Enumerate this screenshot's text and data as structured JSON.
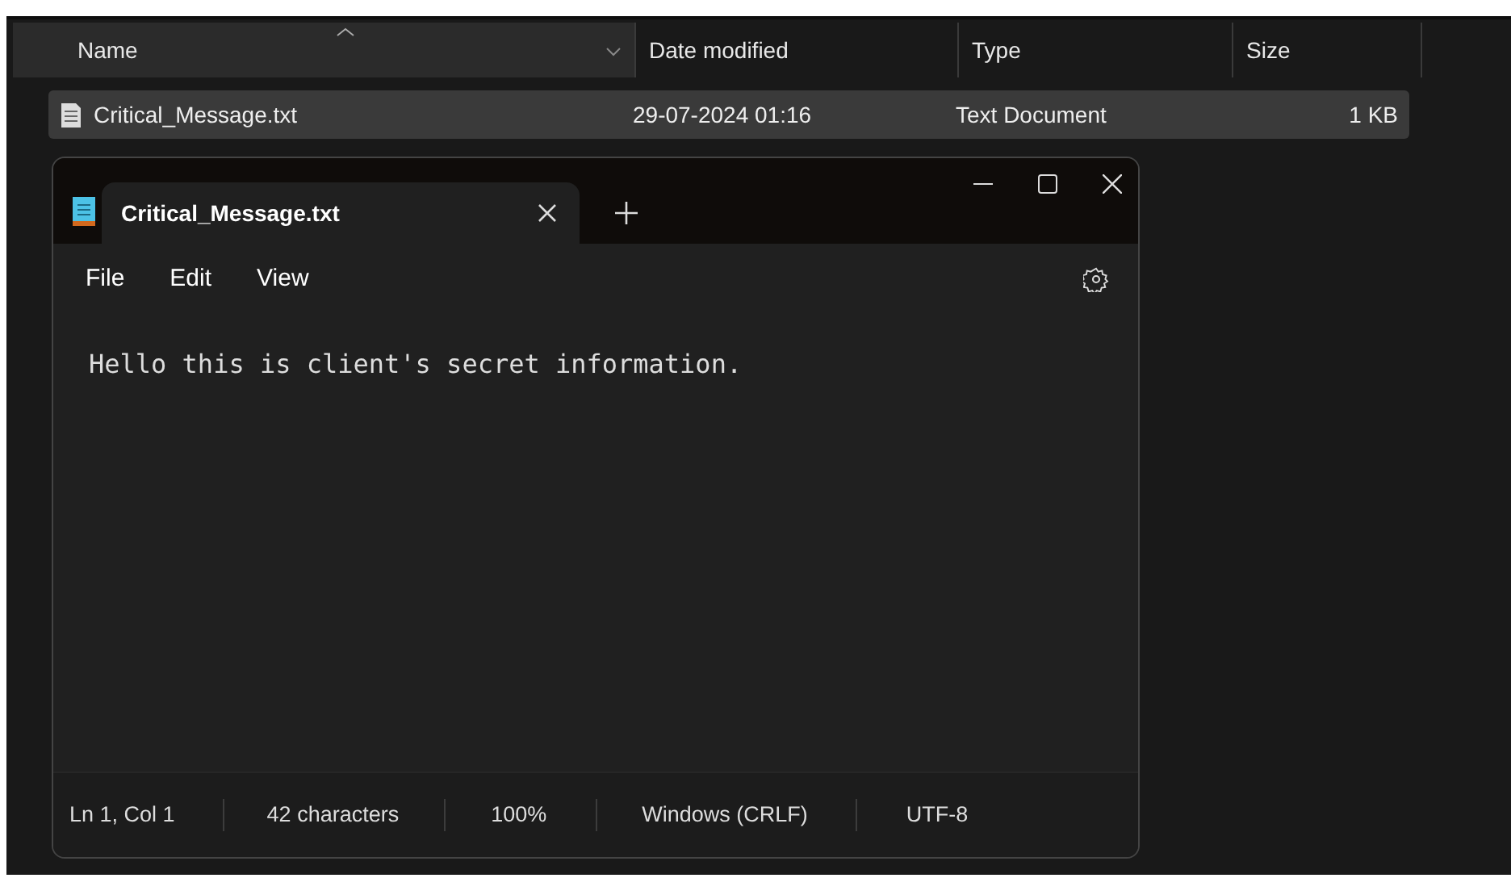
{
  "explorer": {
    "columns": [
      {
        "label": "Name",
        "sorted": true
      },
      {
        "label": "Date modified",
        "sorted": false
      },
      {
        "label": "Type",
        "sorted": false
      },
      {
        "label": "Size",
        "sorted": false
      }
    ],
    "rows": [
      {
        "name": "Critical_Message.txt",
        "date": "29-07-2024 01:16",
        "type": "Text Document",
        "size": "1 KB",
        "selected": true
      }
    ]
  },
  "notepad": {
    "tabs": [
      {
        "title": "Critical_Message.txt",
        "selected": true
      }
    ],
    "menu": [
      "File",
      "Edit",
      "View"
    ],
    "text": "Hello this is client's secret information.",
    "status_bar": [
      "Ln 1, Col 1",
      "42 characters",
      "100%",
      "Windows (CRLF)",
      "UTF-8"
    ]
  }
}
